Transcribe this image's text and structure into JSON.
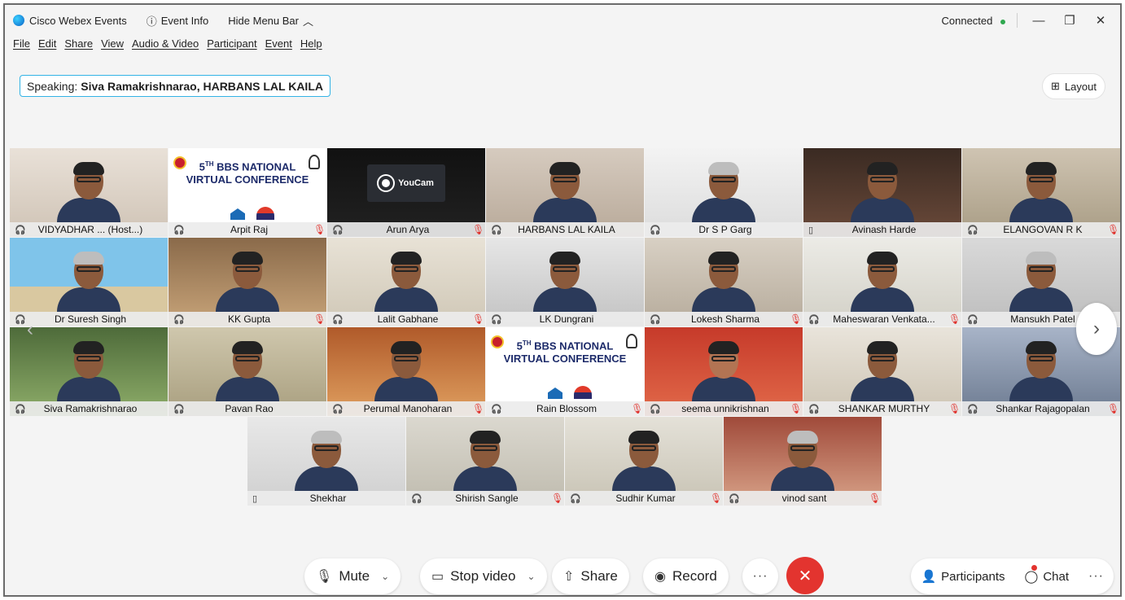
{
  "titlebar": {
    "app_name": "Cisco Webex Events",
    "event_info": "Event Info",
    "hide_menu": "Hide Menu Bar",
    "connection_status": "Connected",
    "minimize": "—",
    "restore": "❐",
    "close": "✕"
  },
  "menu": {
    "items": [
      "File",
      "Edit",
      "Share",
      "View",
      "Audio & Video",
      "Participant",
      "Event",
      "Help"
    ]
  },
  "speaking": {
    "prefix": "Speaking:",
    "names": "Siva Ramakrishnarao, HARBANS LAL KAILA"
  },
  "layout_button": "Layout",
  "poster": {
    "title_num": "5",
    "title_sup": "TH",
    "title_line1": "BBS NATIONAL",
    "title_line2": "VIRTUAL CONFERENCE"
  },
  "youcam": "YouCam",
  "participants": [
    {
      "name": "VIDYADHAR ... (Host...)",
      "muted": false
    },
    {
      "name": "Arpit Raj",
      "muted": true
    },
    {
      "name": "Arun Arya",
      "muted": true
    },
    {
      "name": "HARBANS LAL KAILA",
      "muted": false
    },
    {
      "name": "Dr S P Garg",
      "muted": false
    },
    {
      "name": "Avinash Harde",
      "muted": false
    },
    {
      "name": "ELANGOVAN R K",
      "muted": true
    },
    {
      "name": "Dr Suresh Singh",
      "muted": false
    },
    {
      "name": "KK Gupta",
      "muted": true
    },
    {
      "name": "Lalit Gabhane",
      "muted": true
    },
    {
      "name": "LK Dungrani",
      "muted": false
    },
    {
      "name": "Lokesh Sharma",
      "muted": true
    },
    {
      "name": "Maheswaran Venkata...",
      "muted": true
    },
    {
      "name": "Mansukh Patel",
      "muted": false
    },
    {
      "name": "Siva Ramakrishnarao",
      "muted": false
    },
    {
      "name": "Pavan Rao",
      "muted": false
    },
    {
      "name": "Perumal Manoharan",
      "muted": true
    },
    {
      "name": "Rain Blossom",
      "muted": true
    },
    {
      "name": "seema unnikrishnan",
      "muted": true
    },
    {
      "name": "SHANKAR MURTHY",
      "muted": true
    },
    {
      "name": "Shankar Rajagopalan",
      "muted": true
    },
    {
      "name": "Shekhar",
      "muted": false
    },
    {
      "name": "Shirish Sangle",
      "muted": true
    },
    {
      "name": "Sudhir Kumar",
      "muted": true
    },
    {
      "name": "vinod sant",
      "muted": true
    }
  ],
  "toolbar": {
    "mute": "Mute",
    "stop_video": "Stop video",
    "share": "Share",
    "record": "Record",
    "more": "···",
    "end": "✕",
    "participants": "Participants",
    "chat": "Chat",
    "more_right": "···"
  }
}
